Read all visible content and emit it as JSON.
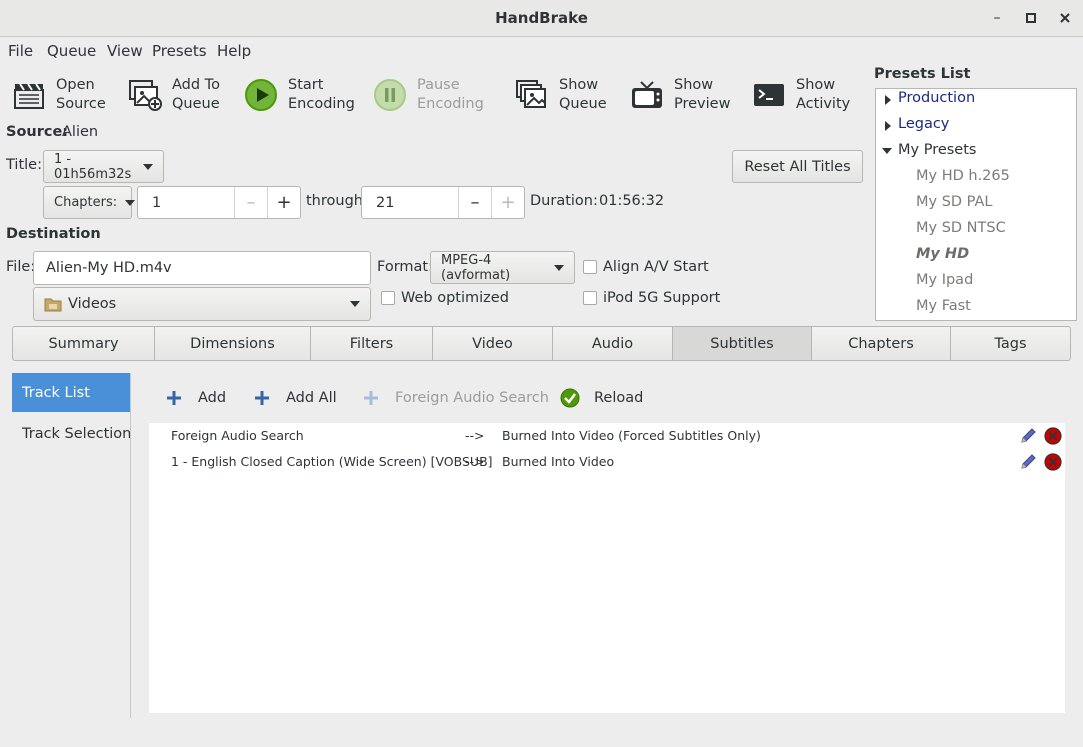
{
  "window": {
    "title": "HandBrake",
    "minimize": "–",
    "maximize": "□",
    "close": "✕"
  },
  "menu": [
    "File",
    "Queue",
    "View",
    "Presets",
    "Help"
  ],
  "toolbar": {
    "open_source": [
      "Open",
      "Source"
    ],
    "add_to_queue": [
      "Add To",
      "Queue"
    ],
    "start_encoding": [
      "Start",
      "Encoding"
    ],
    "pause_encoding": [
      "Pause",
      "Encoding"
    ],
    "show_queue": [
      "Show",
      "Queue"
    ],
    "show_preview": [
      "Show",
      "Preview"
    ],
    "show_activity": [
      "Show",
      "Activity"
    ]
  },
  "source": {
    "label": "Source:",
    "value": "Alien"
  },
  "title_row": {
    "label": "Title:",
    "value": "1 - 01h56m32s",
    "reset_button": "Reset All Titles"
  },
  "range": {
    "mode": "Chapters:",
    "start": "1",
    "through": "through",
    "end": "21",
    "duration_label": "Duration:",
    "duration": "01:56:32",
    "minus": "–",
    "plus": "+"
  },
  "destination": {
    "heading": "Destination",
    "file_label": "File:",
    "file_value": "Alien-My HD.m4v",
    "format_label": "Format:",
    "format_value": "MPEG-4 (avformat)",
    "folder": "Videos",
    "align_av": "Align A/V Start",
    "web_optimized": "Web optimized",
    "ipod": "iPod 5G Support"
  },
  "presets": {
    "heading": "Presets List",
    "groups": [
      "Production",
      "Legacy",
      "My Presets"
    ],
    "items": [
      "My HD h.265",
      "My SD PAL",
      "My SD NTSC",
      "My HD",
      "My Ipad",
      "My Fast"
    ]
  },
  "tabs": [
    "Summary",
    "Dimensions",
    "Filters",
    "Video",
    "Audio",
    "Subtitles",
    "Chapters",
    "Tags"
  ],
  "sidebar": {
    "track_list": "Track List",
    "track_selection": "Track Selection"
  },
  "subtitle_toolbar": {
    "add": "Add",
    "add_all": "Add All",
    "foreign_audio_search": "Foreign Audio Search",
    "reload": "Reload"
  },
  "tracks": [
    {
      "name": "Foreign Audio Search",
      "arrow": "-->",
      "mode": "Burned Into Video (Forced Subtitles Only)"
    },
    {
      "name": "1 - English Closed Caption (Wide Screen) [VOBSUB]",
      "arrow": "-->",
      "mode": "Burned Into Video"
    }
  ],
  "colors": {
    "accent": "#4a90d9",
    "start_green": "#4e9a06",
    "delete_red": "#cc0000"
  }
}
